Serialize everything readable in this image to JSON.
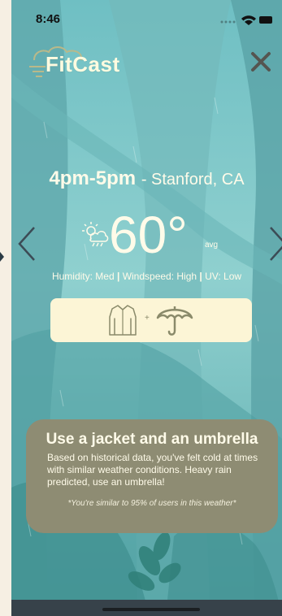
{
  "status_bar": {
    "time": "8:46"
  },
  "app": {
    "logo_text": "FitCast"
  },
  "forecast": {
    "time_range": "4pm-5pm",
    "location": "Stanford, CA",
    "temperature": "60°",
    "temperature_qualifier": "avg",
    "humidity": "Humidity: Med",
    "windspeed": "Windspeed: High",
    "uv": "UV: Low",
    "separator": "|"
  },
  "outfit": {
    "plus": "+",
    "items": [
      "jacket-icon",
      "umbrella-icon"
    ]
  },
  "advice": {
    "title": "Use a jacket and an umbrella",
    "body": "Based on historical data, you've felt cold at times with similar weather conditions. Heavy rain predicted, use an umbrella!",
    "note": "*You're similar to 95% of users in this weather*"
  },
  "colors": {
    "background": "#7fc6c7",
    "logo": "#fffbe0",
    "outfit_card": "#fcf5d6",
    "advice_card": "#8e8c73",
    "icon": "#8a8a6a"
  }
}
